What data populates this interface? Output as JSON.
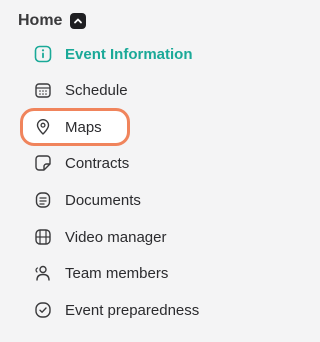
{
  "section": {
    "title": "Home"
  },
  "nav": {
    "items": [
      {
        "label": "Event Information",
        "icon": "info-icon",
        "active": true
      },
      {
        "label": "Schedule",
        "icon": "calendar-icon"
      },
      {
        "label": "Maps",
        "icon": "map-pin-icon",
        "highlighted": true
      },
      {
        "label": "Contracts",
        "icon": "contract-icon"
      },
      {
        "label": "Documents",
        "icon": "document-icon"
      },
      {
        "label": "Video manager",
        "icon": "video-icon"
      },
      {
        "label": "Team members",
        "icon": "team-icon"
      },
      {
        "label": "Event preparedness",
        "icon": "check-circle-icon"
      }
    ]
  },
  "colors": {
    "active": "#1aa998",
    "highlight_border": "#f0845c",
    "text": "#2b2b2e"
  }
}
